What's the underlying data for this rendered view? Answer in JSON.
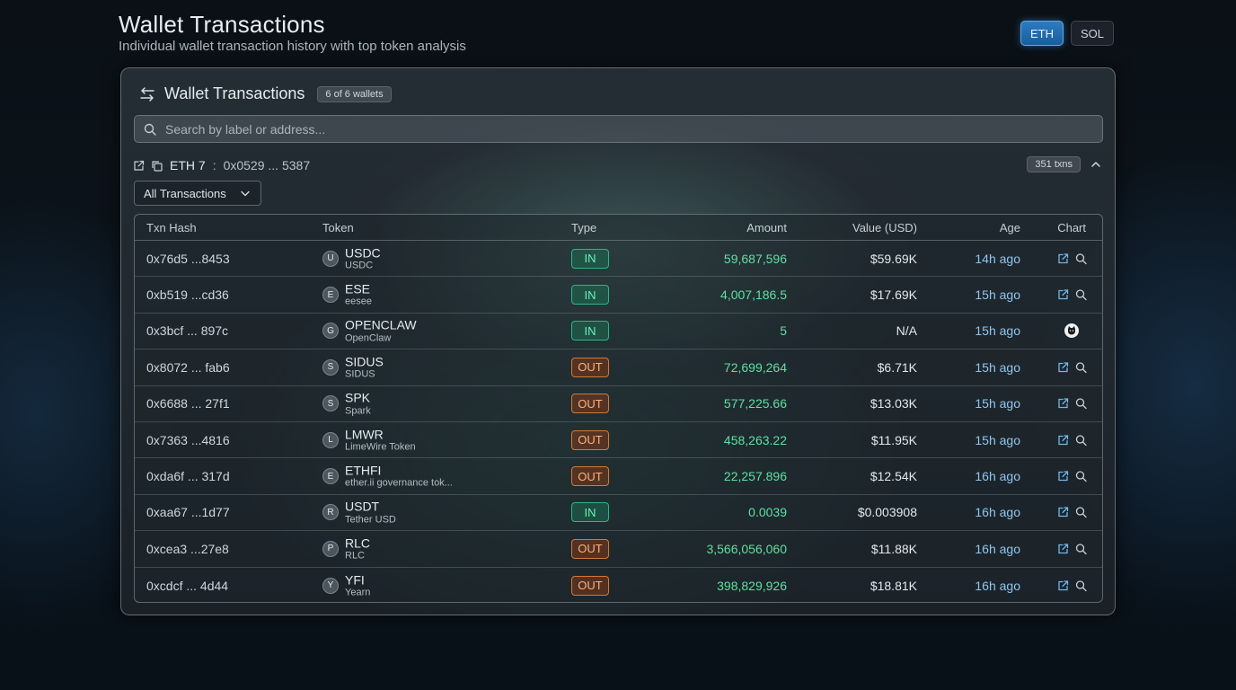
{
  "header": {
    "title": "Wallet Transactions",
    "subtitle": "Individual wallet transaction history with top token analysis"
  },
  "network": {
    "options": [
      "ETH",
      "SOL"
    ],
    "selected": "ETH"
  },
  "panel": {
    "title": "Wallet Transactions",
    "wallet_count": "6 of 6 wallets",
    "icon": "swap-arrows-icon",
    "search_placeholder": "Search by label or address...",
    "wallet": {
      "name": "ETH 7",
      "separator": ":",
      "address": "0x0529 ... 5387",
      "txn_count": "351 txns"
    },
    "filter": {
      "selected": "All Transactions"
    }
  },
  "table": {
    "headers": {
      "hash": "Txn Hash",
      "token": "Token",
      "type": "Type",
      "amount": "Amount",
      "value": "Value (USD)",
      "age": "Age",
      "chart": "Chart"
    },
    "rows": [
      {
        "hash": "0x76d5 ...8453",
        "initial": "U",
        "symbol": "USDC",
        "name": "USDC",
        "type": "IN",
        "amount": "59,687,596",
        "value": "$59.69K",
        "age": "14h ago",
        "chart": "links"
      },
      {
        "hash": "0xb519 ...cd36",
        "initial": "E",
        "symbol": "ESE",
        "name": "eesee",
        "type": "IN",
        "amount": "4,007,186.5",
        "value": "$17.69K",
        "age": "15h ago",
        "chart": "links"
      },
      {
        "hash": "0x3bcf ... 897c",
        "initial": "G",
        "symbol": "OPENCLAW",
        "name": "OpenClaw",
        "type": "IN",
        "amount": "5",
        "value": "N/A",
        "age": "15h ago",
        "chart": "cat"
      },
      {
        "hash": "0x8072 ... fab6",
        "initial": "S",
        "symbol": "SIDUS",
        "name": "SIDUS",
        "type": "OUT",
        "amount": "72,699,264",
        "value": "$6.71K",
        "age": "15h ago",
        "chart": "links"
      },
      {
        "hash": "0x6688 ... 27f1",
        "initial": "S",
        "symbol": "SPK",
        "name": "Spark",
        "type": "OUT",
        "amount": "577,225.66",
        "value": "$13.03K",
        "age": "15h ago",
        "chart": "links"
      },
      {
        "hash": "0x7363 ...4816",
        "initial": "L",
        "symbol": "LMWR",
        "name": "LimeWire Token",
        "type": "OUT",
        "amount": "458,263.22",
        "value": "$11.95K",
        "age": "15h ago",
        "chart": "links"
      },
      {
        "hash": "0xda6f ... 317d",
        "initial": "E",
        "symbol": "ETHFI",
        "name": "ether.ii governance tok...",
        "type": "OUT",
        "amount": "22,257.896",
        "value": "$12.54K",
        "age": "16h ago",
        "chart": "links"
      },
      {
        "hash": "0xaa67 ...1d77",
        "initial": "R",
        "symbol": "USDT",
        "name": "Tether USD",
        "type": "IN",
        "amount": "0.0039",
        "value": "$0.003908",
        "age": "16h ago",
        "chart": "links"
      },
      {
        "hash": "0xcea3 ...27e8",
        "initial": "P",
        "symbol": "RLC",
        "name": "RLC",
        "type": "OUT",
        "amount": "3,566,056,060",
        "value": "$11.88K",
        "age": "16h ago",
        "chart": "links"
      },
      {
        "hash": "0xcdcf ... 4d44",
        "initial": "Y",
        "symbol": "YFI",
        "name": "Yearn",
        "type": "OUT",
        "amount": "398,829,926",
        "value": "$18.81K",
        "age": "16h ago",
        "chart": "links"
      }
    ]
  },
  "colors": {
    "in": "#6ff0b8",
    "out": "#ffb07a",
    "amount": "#5fe0a0",
    "age": "#8fc6ee",
    "accent": "#2d7cc0"
  }
}
